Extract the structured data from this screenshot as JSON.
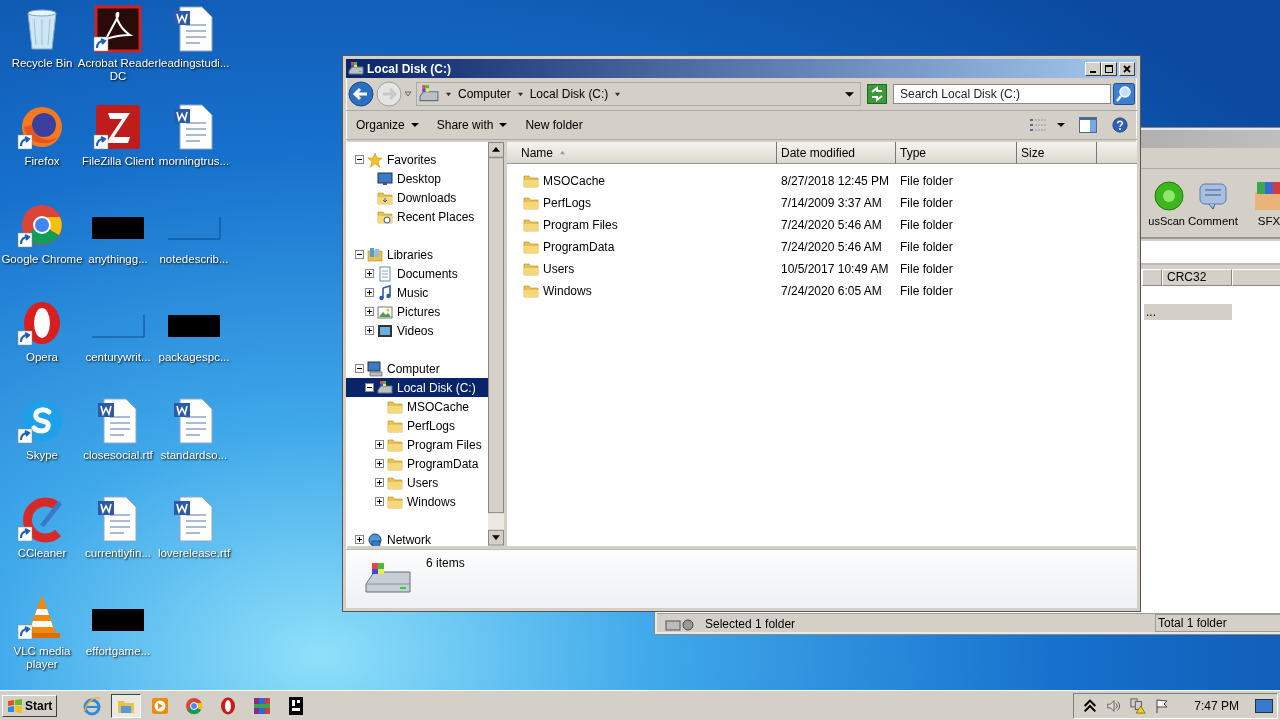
{
  "desktop": {
    "icons": [
      {
        "label": "Recycle Bin",
        "kind": "recycle",
        "shortcut": false
      },
      {
        "label": "Firefox",
        "kind": "firefox",
        "shortcut": true
      },
      {
        "label": "Google Chrome",
        "kind": "chrome",
        "shortcut": true
      },
      {
        "label": "Opera",
        "kind": "opera",
        "shortcut": true
      },
      {
        "label": "Skype",
        "kind": "skype",
        "shortcut": true
      },
      {
        "label": "CCleaner",
        "kind": "ccleaner",
        "shortcut": true
      },
      {
        "label": "VLC media player",
        "kind": "vlc",
        "shortcut": true
      },
      {
        "label": "Acrobat Reader DC",
        "kind": "acrobat",
        "shortcut": true
      },
      {
        "label": "FileZilla Client",
        "kind": "filezilla",
        "shortcut": true
      },
      {
        "label": "anythingg...",
        "kind": "darkthumb",
        "shortcut": false
      },
      {
        "label": "centurywrit...",
        "kind": "blankthumb",
        "shortcut": false
      },
      {
        "label": "closesocial.rtf",
        "kind": "word",
        "shortcut": false
      },
      {
        "label": "currentlyfin...",
        "kind": "word",
        "shortcut": false
      },
      {
        "label": "effortgame...",
        "kind": "darkthumb",
        "shortcut": false
      },
      {
        "label": "leadingstudi...",
        "kind": "word",
        "shortcut": false
      },
      {
        "label": "morningtrus...",
        "kind": "word",
        "shortcut": false
      },
      {
        "label": "notedescrib...",
        "kind": "blankthumb",
        "shortcut": false
      },
      {
        "label": "packagespc...",
        "kind": "darkthumb",
        "shortcut": false
      },
      {
        "label": "standardso...",
        "kind": "word",
        "shortcut": false
      },
      {
        "label": "loverelease.rtf",
        "kind": "word",
        "shortcut": false
      }
    ]
  },
  "background_window": {
    "toolbar": [
      {
        "label": "usScan",
        "kind": "scan"
      },
      {
        "label": "Comment",
        "kind": "comment"
      },
      {
        "label": "SFX",
        "kind": "sfx"
      }
    ],
    "columns": [
      "CRC32"
    ],
    "rows": [
      {
        "name": "...",
        "selected": true
      }
    ],
    "status": [
      "Selected 1 folder",
      "Total 1 folder"
    ]
  },
  "explorer": {
    "title": "Local Disk (C:)",
    "breadcrumb": [
      "Computer",
      "Local Disk (C:)"
    ],
    "search": {
      "placeholder": "Search Local Disk (C:)"
    },
    "commands": [
      {
        "label": "Organize",
        "dropdown": true
      },
      {
        "label": "Share with",
        "dropdown": true
      },
      {
        "label": "New folder",
        "dropdown": false
      }
    ],
    "nav_tree": [
      {
        "label": "Favorites",
        "kind": "star",
        "expanded": true,
        "selected": false,
        "children": [
          {
            "label": "Desktop",
            "kind": "desktop",
            "selected": false
          },
          {
            "label": "Downloads",
            "kind": "downloads",
            "selected": false
          },
          {
            "label": "Recent Places",
            "kind": "recent",
            "selected": false
          }
        ]
      },
      {
        "label": "Libraries",
        "kind": "library",
        "expanded": true,
        "selected": false,
        "children": [
          {
            "label": "Documents",
            "kind": "documents",
            "expanded": false,
            "selected": false
          },
          {
            "label": "Music",
            "kind": "music",
            "expanded": false,
            "selected": false
          },
          {
            "label": "Pictures",
            "kind": "pictures",
            "expanded": false,
            "selected": false
          },
          {
            "label": "Videos",
            "kind": "videos",
            "expanded": false,
            "selected": false
          }
        ]
      },
      {
        "label": "Computer",
        "kind": "computer",
        "expanded": true,
        "selected": false,
        "children": [
          {
            "label": "Local Disk (C:)",
            "kind": "drive",
            "expanded": true,
            "selected": true,
            "children": [
              {
                "label": "MSOCache",
                "kind": "folder",
                "selected": false
              },
              {
                "label": "PerfLogs",
                "kind": "folder",
                "selected": false
              },
              {
                "label": "Program Files",
                "kind": "folder",
                "expanded": false,
                "selected": false
              },
              {
                "label": "ProgramData",
                "kind": "folder",
                "expanded": false,
                "selected": false
              },
              {
                "label": "Users",
                "kind": "folder",
                "expanded": false,
                "selected": false
              },
              {
                "label": "Windows",
                "kind": "folder",
                "expanded": false,
                "selected": false
              }
            ]
          }
        ]
      },
      {
        "label": "Network",
        "kind": "network",
        "expanded": false,
        "selected": false
      }
    ],
    "columns": [
      {
        "label": "Name",
        "sorted": true
      },
      {
        "label": "Date modified",
        "sorted": false
      },
      {
        "label": "Type",
        "sorted": false
      },
      {
        "label": "Size",
        "sorted": false
      }
    ],
    "rows": [
      {
        "name": "MSOCache",
        "date": "8/27/2018 12:45 PM",
        "type": "File folder"
      },
      {
        "name": "PerfLogs",
        "date": "7/14/2009 3:37 AM",
        "type": "File folder"
      },
      {
        "name": "Program Files",
        "date": "7/24/2020 5:46 AM",
        "type": "File folder"
      },
      {
        "name": "ProgramData",
        "date": "7/24/2020 5:46 AM",
        "type": "File folder"
      },
      {
        "name": "Users",
        "date": "10/5/2017 10:49 AM",
        "type": "File folder"
      },
      {
        "name": "Windows",
        "date": "7/24/2020 6:05 AM",
        "type": "File folder"
      }
    ],
    "details": "6 items"
  },
  "taskbar": {
    "start": "Start",
    "apps": [
      {
        "kind": "ie",
        "active": false
      },
      {
        "kind": "explorer",
        "active": true
      },
      {
        "kind": "mediaplayer",
        "active": false
      },
      {
        "kind": "chrome",
        "active": false
      },
      {
        "kind": "opera",
        "active": false
      },
      {
        "kind": "winrar",
        "active": false
      },
      {
        "kind": "other",
        "active": false
      }
    ],
    "clock": "7:47 PM"
  }
}
